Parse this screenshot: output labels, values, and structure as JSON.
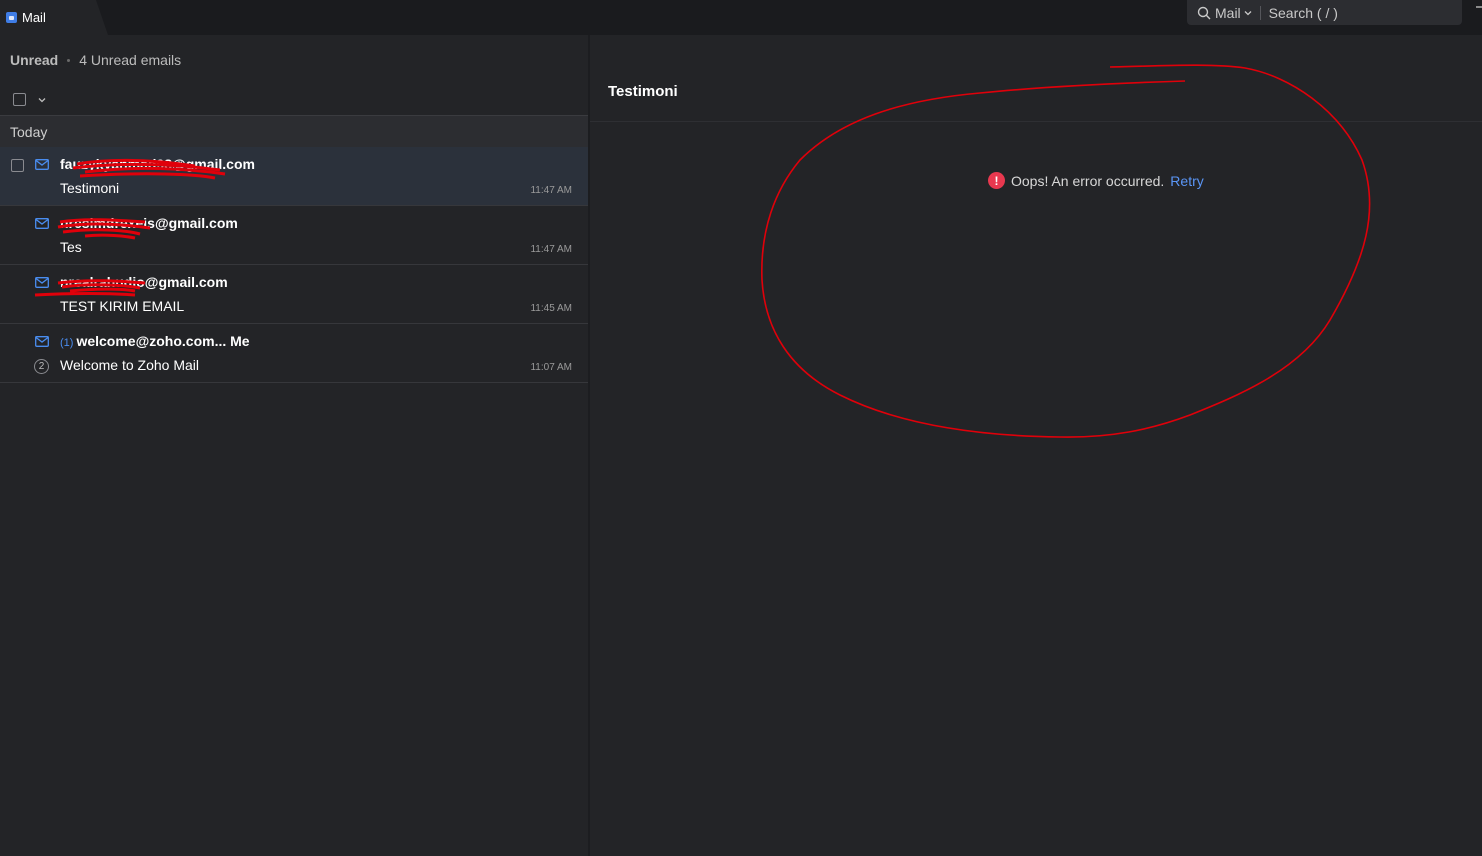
{
  "app": {
    "title": "Mail"
  },
  "search": {
    "scope": "Mail",
    "placeholder": "Search ( / )"
  },
  "list": {
    "folder": "Unread",
    "unread_summary": "4 Unread emails",
    "group_label": "Today",
    "emails": [
      {
        "sender": "fauzykyahmad98@gmail.com",
        "subject": "Testimoni",
        "time": "11:47 AM",
        "selected": true
      },
      {
        "sender": "nresimdrexeis@gmail.com",
        "subject": "Tes",
        "time": "11:47 AM"
      },
      {
        "sender": "nrealrahudio@gmail.com",
        "subject": "TEST KIRIM EMAIL",
        "time": "11:45 AM"
      },
      {
        "thread_count": "(1)",
        "sender": "welcome@zoho.com... Me",
        "subject": "Welcome to Zoho Mail",
        "time": "11:07 AM",
        "thread_badge": "2"
      }
    ]
  },
  "reading": {
    "subject": "Testimoni",
    "error_text": "Oops! An error occurred.",
    "retry_label": "Retry"
  },
  "colors": {
    "accent": "#4a8df0",
    "error": "#e8384f",
    "annotation": "#e0000a"
  }
}
